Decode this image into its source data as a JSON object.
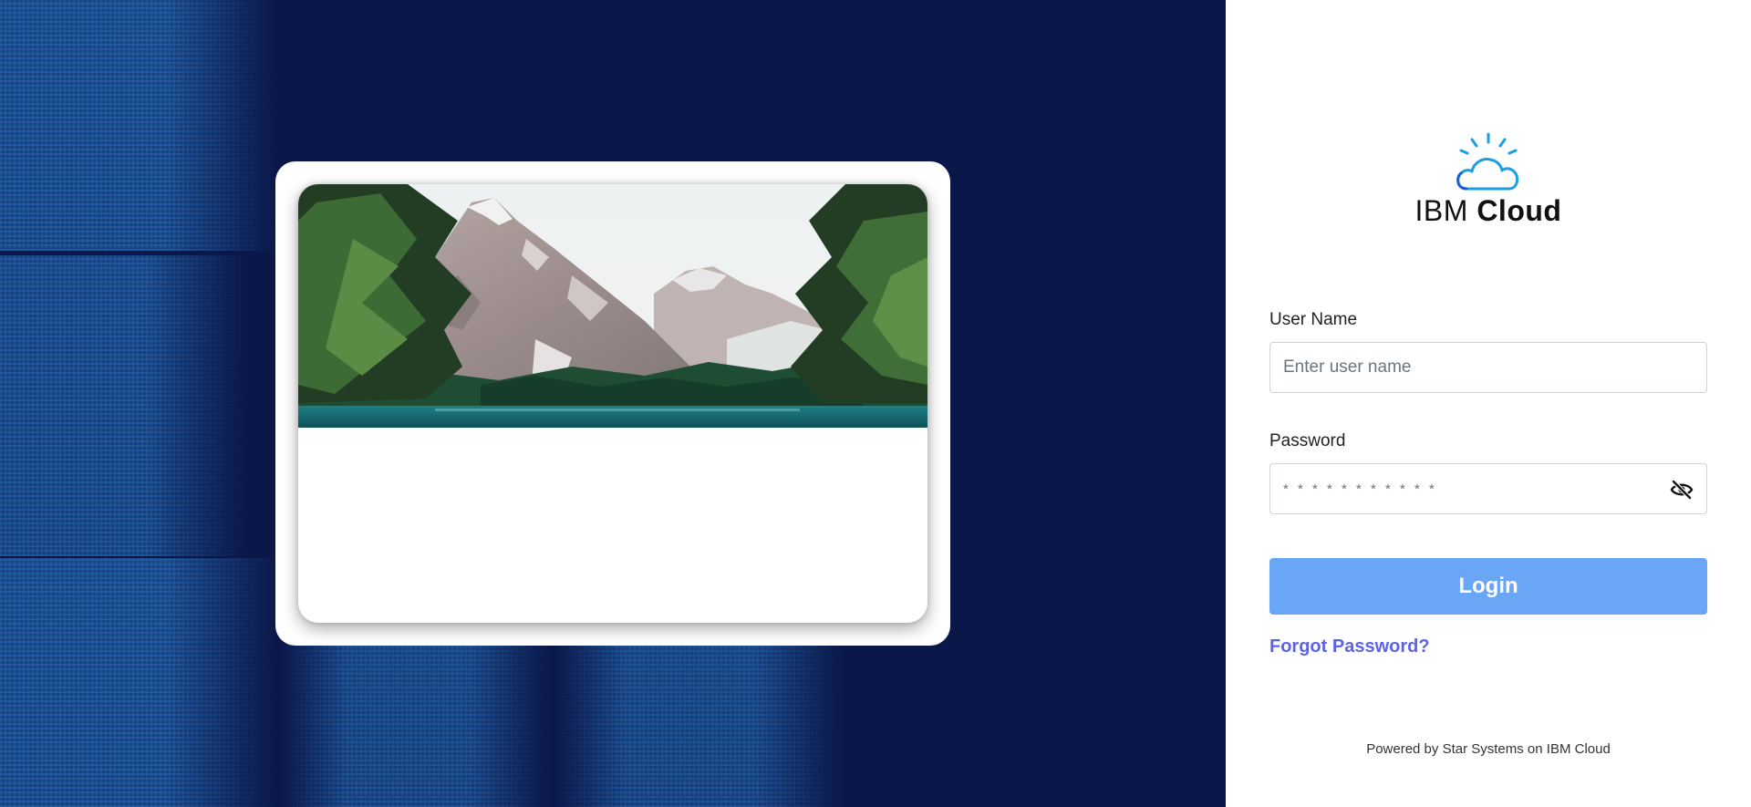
{
  "brand": {
    "logo_light": "IBM",
    "logo_bold": "Cloud"
  },
  "login": {
    "username_label": "User Name",
    "username_placeholder": "Enter user name",
    "password_label": "Password",
    "password_placeholder": "* * * * * * * * * * *",
    "login_button": "Login",
    "forgot_password": "Forgot Password?"
  },
  "footer": {
    "text": "Powered by Star Systems on IBM Cloud"
  },
  "colors": {
    "hero_background": "#0b1748",
    "login_button": "#6aa6f6",
    "link": "#5c63e6",
    "logo_cloud": "#1a9fe0"
  },
  "icons": {
    "logo": "ibm-cloud-logo-icon",
    "password_toggle": "eye-slash-icon"
  }
}
